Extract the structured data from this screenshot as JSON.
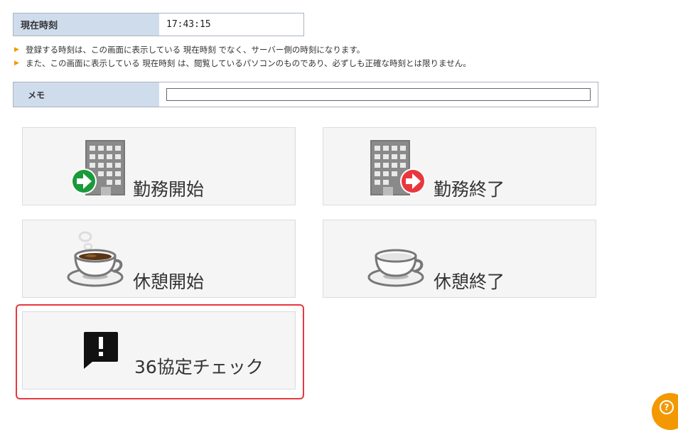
{
  "current_time": {
    "label": "現在時刻",
    "value": "17:43:15"
  },
  "notes": [
    "登録する時刻は、この画面に表示している 現在時刻 でなく、サーバー側の時刻になります。",
    "また、この画面に表示している 現在時刻 は、閲覧しているパソコンのものであり、必ずしも正確な時刻とは限りません。"
  ],
  "memo": {
    "label": "メモ",
    "value": ""
  },
  "buttons": {
    "work_start": {
      "label": "勤務開始",
      "icon": "building-arrow-in-icon",
      "accent": "#1a9a3a"
    },
    "work_end": {
      "label": "勤務終了",
      "icon": "building-arrow-out-icon",
      "accent": "#e8383d"
    },
    "break_start": {
      "label": "休憩開始",
      "icon": "coffee-cup-steam-icon"
    },
    "break_end": {
      "label": "休憩終了",
      "icon": "empty-cup-icon"
    },
    "agreement_check": {
      "label": "36協定チェック",
      "icon": "alert-bubble-icon"
    }
  },
  "help": {
    "icon": "help-icon"
  },
  "colors": {
    "header_bg": "#cfdcec",
    "arrow": "#f39800",
    "highlight": "#e8383d"
  }
}
